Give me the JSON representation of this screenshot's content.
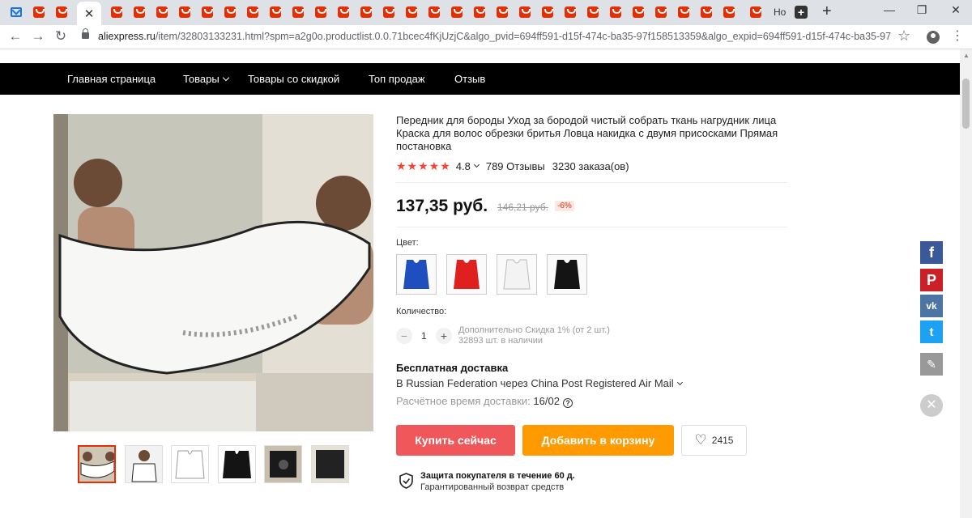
{
  "browser": {
    "tab_active_close": "✕",
    "tab_text": "Но",
    "new_tab": "+",
    "window": {
      "minimize": "—",
      "restore": "❐",
      "close": "✕"
    },
    "nav": {
      "back": "←",
      "forward": "→",
      "reload": "↻"
    },
    "url_host": "aliexpress.ru",
    "url_path": "/item/32803133231.html?spm=a2g0o.productlist.0.0.71bcec4fKjUzjC&algo_pvid=694ff591-d15f-474c-ba35-97f158513359&algo_expid=694ff591-d15f-474c-ba35-97...",
    "bookmark_icon": "☆",
    "menu_icon": "⋮",
    "favicon_color": "#e62e04"
  },
  "topnav": {
    "items": [
      "Главная страница",
      "Товары",
      "Товары со скидкой",
      "Топ продаж",
      "Отзыв"
    ]
  },
  "product": {
    "title": "Передник для бороды Уход за бородой чистый собрать ткань нагрудник лица Краска для волос обрезки бритья Ловца накидка с двумя присосками Прямая постановка",
    "stars": "★★★★★",
    "rating": "4.8",
    "reviews": "789 Отзывы",
    "orders": "3230 заказа(ов)",
    "price": "137,35 руб.",
    "old_price": "146,21 руб.",
    "discount": "-6%",
    "color_label": "Цвет:",
    "colors": [
      {
        "name": "blue",
        "hex": "#1f4fbf"
      },
      {
        "name": "red",
        "hex": "#e0201e"
      },
      {
        "name": "white",
        "hex": "#f3f3f3"
      },
      {
        "name": "black",
        "hex": "#141414"
      }
    ],
    "quantity_label": "Количество:",
    "qty_minus": "−",
    "qty_value": "1",
    "qty_plus": "+",
    "bulk_discount": "Дополнительно Скидка 1% (от 2 шт.)",
    "stock": "32893 шт. в наличии",
    "shipping_title": "Бесплатная доставка",
    "shipping_route": "В Russian Federation через China Post Registered Air Mail",
    "eta_label": "Расчётное время доставки: ",
    "eta_value": "16/02",
    "buy_now": "Купить сейчас",
    "add_to_cart": "Добавить в корзину",
    "wishlist_count": "2415",
    "protection_title": "Защита покупателя в течение 60 д.",
    "protection_sub": "Гарантированный возврат средств"
  },
  "share": {
    "facebook": "f",
    "pinterest": "P",
    "vk": "vk",
    "twitter": "t",
    "edit": "✎",
    "close": "✕"
  },
  "colors": {
    "buy": "#f0575a",
    "cart": "#ff9a00",
    "nav_bg": "#000000",
    "accent": "#e62e04"
  }
}
